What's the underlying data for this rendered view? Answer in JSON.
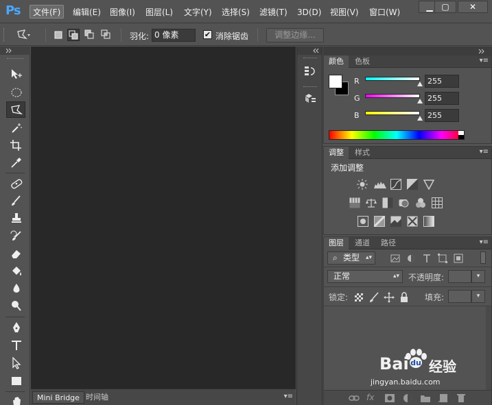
{
  "app": {
    "logo": "Ps"
  },
  "menu": {
    "items": [
      "文件(F)",
      "编辑(E)",
      "图像(I)",
      "图层(L)",
      "文字(Y)",
      "选择(S)",
      "滤镜(T)",
      "3D(D)",
      "视图(V)",
      "窗口(W)"
    ],
    "active_index": 0
  },
  "window_controls": {
    "minimize": "▁",
    "maximize": "▢",
    "close": "✕"
  },
  "options_bar": {
    "feather_label": "羽化:",
    "feather_value": "0 像素",
    "antialias_label": "消除锯齿",
    "antialias_checked": "✔",
    "refine_edge_label": "调整边缘..."
  },
  "canvas": {
    "bottom_tabs": [
      "Mini Bridge",
      "时间轴"
    ]
  },
  "color_panel": {
    "tabs": [
      "颜色",
      "色板"
    ],
    "channels": [
      {
        "label": "R",
        "value": "255"
      },
      {
        "label": "G",
        "value": "255"
      },
      {
        "label": "B",
        "value": "255"
      }
    ],
    "foreground": "#ffffff",
    "background": "#000000"
  },
  "adjustments_panel": {
    "tabs": [
      "调整",
      "样式"
    ],
    "title": "添加调整"
  },
  "layers_panel": {
    "tabs": [
      "图层",
      "通道",
      "路径"
    ],
    "filter_kind": "类型",
    "blend_mode": "正常",
    "opacity_label": "不透明度:",
    "lock_label": "锁定:",
    "fill_label": "填充:"
  },
  "watermark": {
    "brand": "Bai",
    "brand_cn": "经验",
    "url": "jingyan.baidu.com"
  }
}
